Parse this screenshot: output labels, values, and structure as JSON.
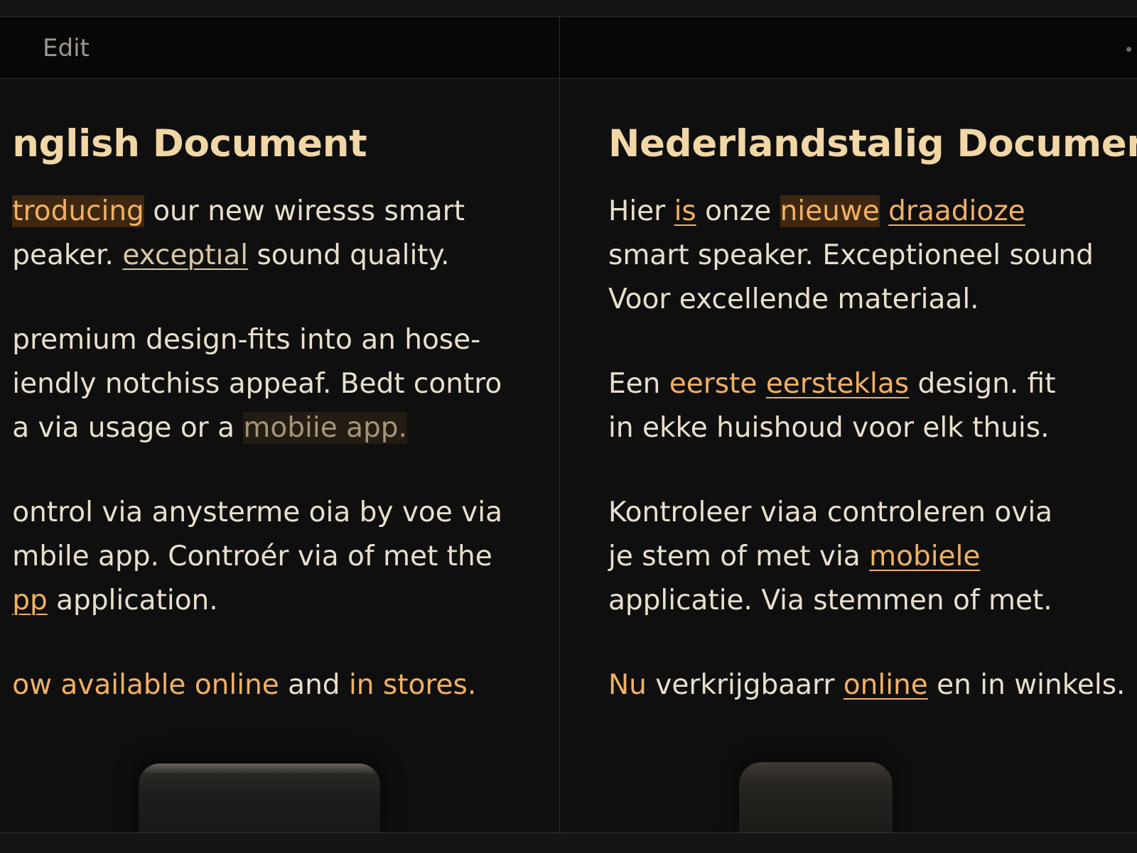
{
  "toolbar": {
    "edit_label": "Edit"
  },
  "left_doc": {
    "title": "nglish Document",
    "p1": {
      "a": "troducing",
      "b": " our new wiresss smart",
      "c": "peaker. ",
      "d": "exceptıal",
      "e": " sound quality."
    },
    "p2": {
      "a": " premium design-fits into an hose-",
      "b": "iendly notchiss appeaf. Bedt contro",
      "c": "a via usage or a ",
      "d": "mobiie app."
    },
    "p3": {
      "a": "ontrol via anysterme oia by voe via",
      "b": "mbile app. Controér  via of met the",
      "c": "pp",
      "d": " application."
    },
    "p4": {
      "a": "ow available online",
      "b": " and ",
      "c": "in stores."
    }
  },
  "right_doc": {
    "title": "Nederlandstalig Document",
    "p1": {
      "a": "Hier ",
      "b": "is",
      "c": " onze ",
      "d": "nieuwe",
      "e": " ",
      "f": "draadioze",
      "g": "smart speaker. Exceptioneel sound",
      "h": "Voor excellende materiaal."
    },
    "p2": {
      "a": "Een ",
      "b": "eerste",
      "c": " ",
      "d": "eersteklas",
      "e": " design. fit",
      "f": "in ekke huishoud voor elk thuis."
    },
    "p3": {
      "a": "Kontroleer viaa controleren ovia",
      "b": "je stem of met via ",
      "c": "mobiele",
      "d": "applicatie. Via stemmen of met."
    },
    "p4": {
      "a": "Nu",
      "b": " verkrijgbaarr ",
      "c": "online",
      "d": " en in winkels."
    }
  }
}
